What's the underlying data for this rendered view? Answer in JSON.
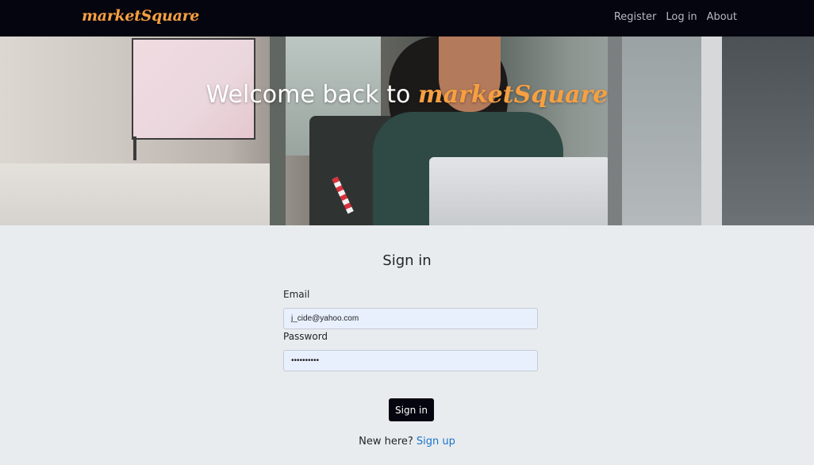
{
  "navbar": {
    "brand": "marketSquare",
    "links": [
      "Register",
      "Log in",
      "About"
    ]
  },
  "hero": {
    "title_prefix": "Welcome back to ",
    "title_brand": "marketSquare"
  },
  "form": {
    "title": "Sign in",
    "email_label": "Email",
    "email_value": "j_cide@yahoo.com",
    "password_label": "Password",
    "password_value": "••••••••••",
    "submit_label": "Sign in"
  },
  "footer": {
    "prompt": "New here? ",
    "signup_label": "Sign up"
  },
  "colors": {
    "navbar_bg": "#05050f",
    "brand_orange": "#f7a041",
    "page_bg": "#e9ecef",
    "input_bg": "#e8f0fe",
    "link_blue": "#1a73c9"
  }
}
